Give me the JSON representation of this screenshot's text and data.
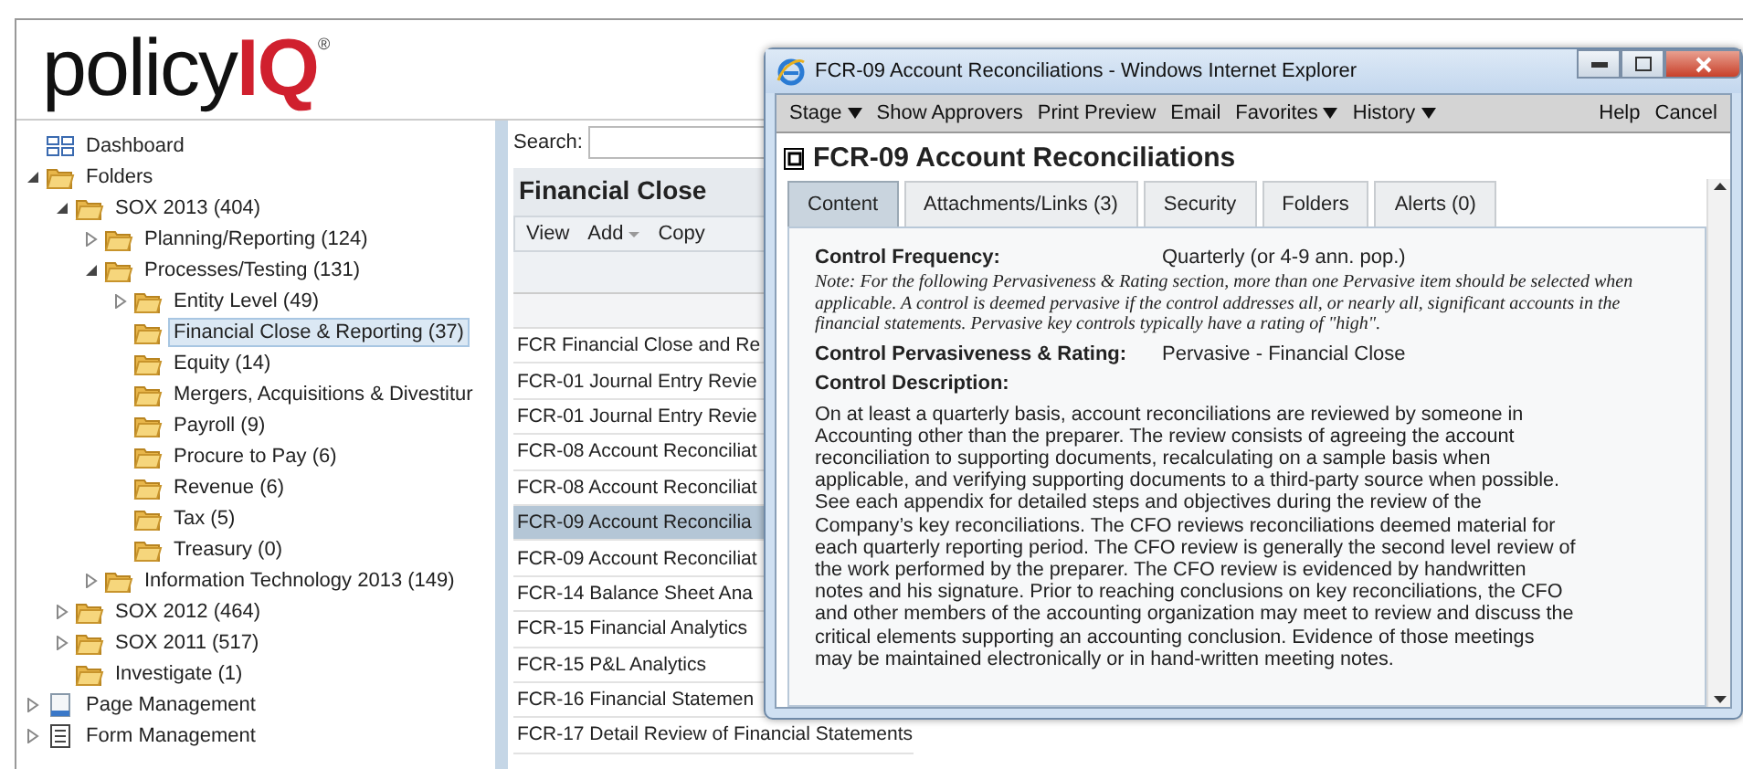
{
  "app": {
    "logo": {
      "text": "policy",
      "accent": "IQ",
      "mark": "®"
    },
    "tree": [
      {
        "label": "Dashboard",
        "kind": "dashboard"
      },
      {
        "label": "Folders",
        "kind": "folder",
        "expanded": true,
        "children": [
          {
            "label": "SOX 2013 (404)",
            "kind": "folder",
            "expanded": true,
            "children": [
              {
                "label": "Planning/Reporting (124)",
                "kind": "folder",
                "expanded": false
              },
              {
                "label": "Processes/Testing (131)",
                "kind": "folder",
                "expanded": true,
                "children": [
                  {
                    "label": "Entity Level (49)",
                    "kind": "folder",
                    "expanded": false
                  },
                  {
                    "label": "Financial Close & Reporting (37)",
                    "kind": "folder",
                    "selected": true
                  },
                  {
                    "label": "Equity (14)",
                    "kind": "folder",
                    "selected": false
                  },
                  {
                    "label": "Mergers, Acquisitions & Divestitur",
                    "kind": "folder",
                    "selected": false
                  },
                  {
                    "label": "Payroll (9)",
                    "kind": "folder",
                    "selected": false
                  },
                  {
                    "label": "Procure to Pay (6)",
                    "kind": "folder",
                    "selected": false
                  },
                  {
                    "label": "Revenue (6)",
                    "kind": "folder",
                    "selected": false
                  },
                  {
                    "label": "Tax (5)",
                    "kind": "folder",
                    "selected": false
                  },
                  {
                    "label": "Treasury (0)",
                    "kind": "folder",
                    "selected": false
                  }
                ]
              },
              {
                "label": "Information Technology 2013 (149)",
                "kind": "folder",
                "expanded": false
              }
            ]
          },
          {
            "label": "SOX 2012 (464)",
            "kind": "folder",
            "expanded": false
          },
          {
            "label": "SOX 2011 (517)",
            "kind": "folder",
            "expanded": false
          },
          {
            "label": "Investigate (1)",
            "kind": "folder",
            "selected": false
          }
        ]
      },
      {
        "label": "Page Management",
        "kind": "page",
        "expanded": false
      },
      {
        "label": "Form Management",
        "kind": "form",
        "expanded": false
      }
    ],
    "list": {
      "search_label": "Search:",
      "title": "Financial Close",
      "toolbar": [
        {
          "label": "View",
          "kind": "plain"
        },
        {
          "label": "Add",
          "kind": "menu"
        },
        {
          "label": "Copy",
          "kind": "plain"
        }
      ],
      "rows": [
        {
          "label": "FCR Financial Close and Re",
          "selected": false
        },
        {
          "label": "FCR-01 Journal Entry Revie",
          "selected": false
        },
        {
          "label": "FCR-01 Journal Entry Revie",
          "selected": false
        },
        {
          "label": "FCR-08 Account Reconciliat",
          "selected": false
        },
        {
          "label": "FCR-08 Account Reconciliat",
          "selected": false
        },
        {
          "label": "FCR-09 Account Reconcilia",
          "selected": true
        },
        {
          "label": "FCR-09 Account Reconciliat",
          "selected": false
        },
        {
          "label": "FCR-14 Balance Sheet Ana",
          "selected": false
        },
        {
          "label": "FCR-15 Financial Analytics",
          "selected": false
        },
        {
          "label": "FCR-15 P&L Analytics",
          "selected": false
        },
        {
          "label": "FCR-16 Financial Statemen",
          "selected": false
        },
        {
          "label": "FCR-17 Detail Review of Financial Statements",
          "selected": false
        }
      ]
    }
  },
  "popup": {
    "window": {
      "title": "FCR-09 Account Reconciliations - Windows Internet Explorer"
    },
    "menu": [
      {
        "label": "Stage",
        "kind": "dropdown"
      },
      {
        "label": "Show Approvers",
        "kind": "plain"
      },
      {
        "label": "Print Preview",
        "kind": "plain"
      },
      {
        "label": "Email",
        "kind": "plain"
      },
      {
        "label": "Favorites",
        "kind": "dropdown"
      },
      {
        "label": "History",
        "kind": "dropdown"
      },
      {
        "label": "Help",
        "kind": "right"
      },
      {
        "label": "Cancel",
        "kind": "right"
      }
    ],
    "heading": "FCR-09 Account Reconciliations",
    "tabs": [
      {
        "label": "Content",
        "selected": true
      },
      {
        "label": "Attachments/Links (3)",
        "selected": false
      },
      {
        "label": "Security",
        "selected": false
      },
      {
        "label": "Folders",
        "selected": false
      },
      {
        "label": "Alerts (0)",
        "selected": false
      }
    ],
    "fields": [
      {
        "kind": "pair",
        "label": "Control Frequency:",
        "value": "Quarterly (or 4-9 ann. pop.)"
      },
      {
        "kind": "note",
        "text": "Note: For the following Pervasiveness & Rating section, more than one Pervasive item should be selected when applicable. A control is deemed pervasive if the control addresses all, or nearly all, significant accounts in the financial statements. Pervasive key controls typically have a rating of \"high\"."
      },
      {
        "kind": "pair",
        "label": "Control Pervasiveness & Rating:",
        "value": "Pervasive - Financial Close"
      },
      {
        "kind": "heading",
        "label": "Control Description:"
      },
      {
        "kind": "paragraph",
        "text": "On at least a quarterly basis, account reconciliations are reviewed by someone in Accounting other than the preparer. The review consists of agreeing the account reconciliation to supporting documents, recalculating on a sample basis when applicable, and verifying supporting documents to a third-party source when possible. See each appendix for detailed steps and objectives during the review of the Company’s key reconciliations. The CFO reviews reconciliations deemed material for each quarterly reporting period. The CFO review is generally the second level review of the work performed by the preparer. The CFO review is evidenced by handwritten notes and his signature. Prior to reaching conclusions on key reconciliations, the CFO and other members of the accounting organization may meet to review and discuss the critical elements supporting an accounting conclusion. Evidence of those meetings may be maintained electronically or in hand-written meeting notes."
      }
    ]
  }
}
